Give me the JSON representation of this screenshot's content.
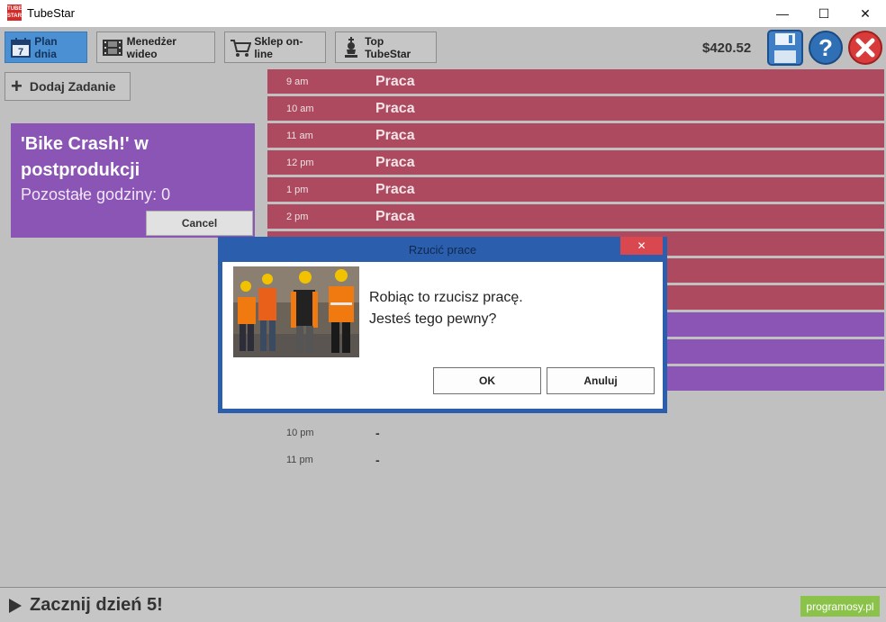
{
  "window": {
    "title": "TubeStar",
    "app_icon_text": "TUBE STAR",
    "minimize": "—",
    "maximize": "☐",
    "close": "✕"
  },
  "toolbar": {
    "plan": "Plan dnia",
    "plan_icon_day": "7",
    "video": "Menedżer wideo",
    "shop": "Sklep on-line",
    "top": "Top TubeStar",
    "money": "$420.52"
  },
  "left": {
    "add_task": "Dodaj Zadanie",
    "project_title": "'Bike Crash!' w postprodukcji",
    "project_hours": "Pozostałe godziny: 0",
    "cancel": "Cancel"
  },
  "schedule": {
    "slots": [
      {
        "time": "9 am",
        "label": "Praca"
      },
      {
        "time": "10 am",
        "label": "Praca"
      },
      {
        "time": "11 am",
        "label": "Praca"
      },
      {
        "time": "12 pm",
        "label": "Praca"
      },
      {
        "time": "1 pm",
        "label": "Praca"
      },
      {
        "time": "2 pm",
        "label": "Praca"
      },
      {
        "time": "10 pm",
        "label": "-"
      },
      {
        "time": "11 pm",
        "label": "-"
      }
    ]
  },
  "footer": {
    "start": "Zacznij dzień 5!",
    "brand": "programosy.pl"
  },
  "dialog": {
    "title": "Rzucić prace",
    "close": "✕",
    "line1": "Robiąc to rzucisz pracę.",
    "line2": "Jesteś tego pewny?",
    "ok": "OK",
    "cancel": "Anuluj"
  },
  "colors": {
    "work_slot": "#ad4a5f",
    "project_slot": "#8a55b5",
    "active_tab": "#4a90d2",
    "dialog_frame": "#2b5fad"
  }
}
